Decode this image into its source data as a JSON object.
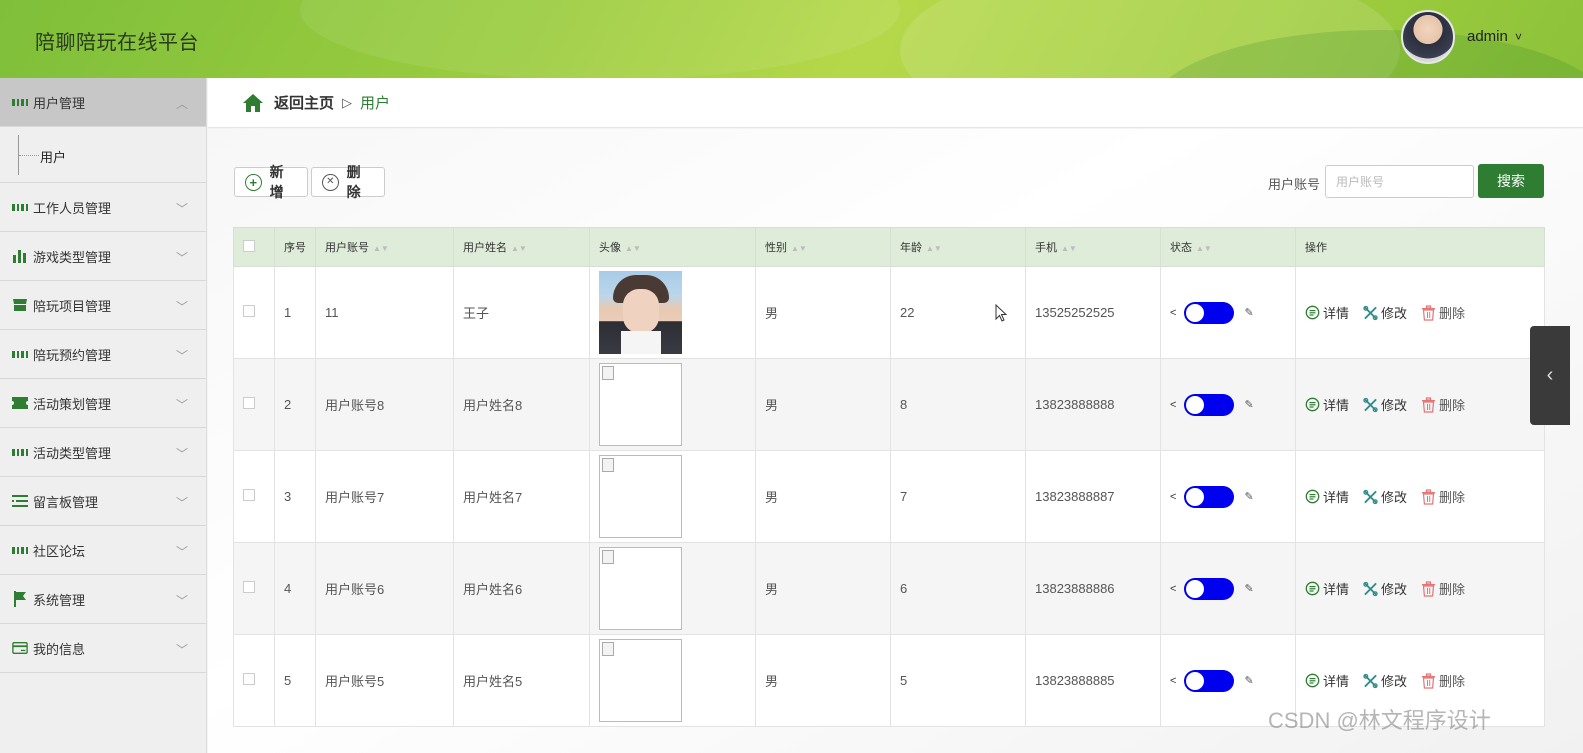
{
  "header": {
    "title": "陪聊陪玩在线平台",
    "user": "admin",
    "user_chevron": "˅"
  },
  "sidebar": {
    "items": [
      {
        "label": "用户管理",
        "icon": "grid-icon",
        "expanded": true,
        "children": [
          {
            "label": "用户"
          }
        ]
      },
      {
        "label": "工作人员管理",
        "icon": "grid-icon"
      },
      {
        "label": "游戏类型管理",
        "icon": "bar-chart-icon"
      },
      {
        "label": "陪玩项目管理",
        "icon": "store-icon"
      },
      {
        "label": "陪玩预约管理",
        "icon": "grid-icon"
      },
      {
        "label": "活动策划管理",
        "icon": "ticket-icon"
      },
      {
        "label": "活动类型管理",
        "icon": "grid-icon"
      },
      {
        "label": "留言板管理",
        "icon": "list-icon"
      },
      {
        "label": "社区论坛",
        "icon": "grid-icon"
      },
      {
        "label": "系统管理",
        "icon": "flag-icon"
      },
      {
        "label": "我的信息",
        "icon": "card-icon"
      }
    ]
  },
  "breadcrumb": {
    "home": "返回主页",
    "separator": "▷",
    "current": "用户"
  },
  "toolbar": {
    "add_label": "新增",
    "delete_label": "删除",
    "search_label": "用户账号",
    "search_placeholder": "用户账号",
    "search_button": "搜索"
  },
  "table": {
    "columns": [
      "序号",
      "用户账号",
      "用户姓名",
      "头像",
      "性别",
      "年龄",
      "手机",
      "状态",
      "操作"
    ],
    "sortable": [
      false,
      true,
      true,
      true,
      true,
      true,
      true,
      true,
      false
    ],
    "rows": [
      {
        "index": "1",
        "account": "11",
        "name": "王子",
        "avatar": "photo",
        "gender": "男",
        "age": "22",
        "phone": "13525252525",
        "enabled": true
      },
      {
        "index": "2",
        "account": "用户账号8",
        "name": "用户姓名8",
        "avatar": "broken",
        "gender": "男",
        "age": "8",
        "phone": "13823888888",
        "enabled": true
      },
      {
        "index": "3",
        "account": "用户账号7",
        "name": "用户姓名7",
        "avatar": "broken",
        "gender": "男",
        "age": "7",
        "phone": "13823888887",
        "enabled": true
      },
      {
        "index": "4",
        "account": "用户账号6",
        "name": "用户姓名6",
        "avatar": "broken",
        "gender": "男",
        "age": "6",
        "phone": "13823888886",
        "enabled": true
      },
      {
        "index": "5",
        "account": "用户账号5",
        "name": "用户姓名5",
        "avatar": "broken",
        "gender": "男",
        "age": "5",
        "phone": "13823888885",
        "enabled": true
      }
    ],
    "actions": {
      "detail": "详情",
      "edit": "修改",
      "delete": "删除"
    }
  },
  "watermark": "CSDN @林文程序设计",
  "colors": {
    "accent": "#2e7d32",
    "header": "#9ccd3f",
    "toggle": "#0000ee",
    "delete": "#e57373"
  }
}
